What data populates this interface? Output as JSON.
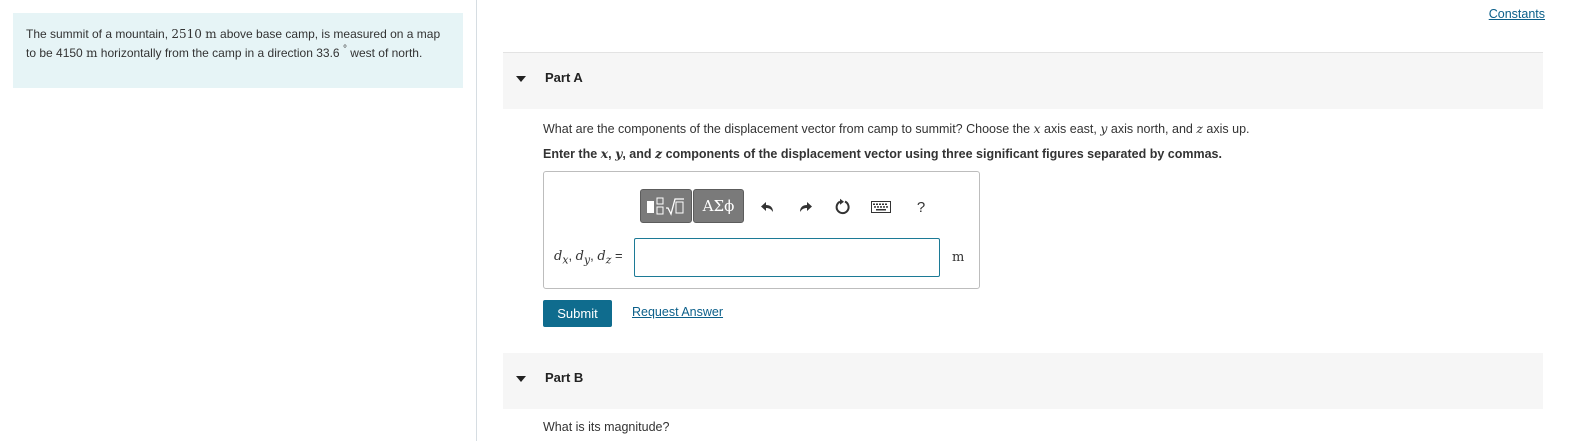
{
  "problem": {
    "lead": "The summit of a mountain, ",
    "height_value": "2510",
    "height_unit": "m",
    "mid1": " above base camp, is measured on a map to be ",
    "distance_value": "4150",
    "distance_unit": "m",
    "mid2": " horizontally from the camp in a direction ",
    "angle_value": "33.6",
    "degree_symbol": "°",
    "tail": " west of north."
  },
  "header": {
    "constants_link": "Constants"
  },
  "part_a": {
    "title": "Part A",
    "question": {
      "q1": "What are the components of the displacement vector from camp to summit? Choose the ",
      "x_var": "x",
      "q2": " axis east, ",
      "y_var": "y",
      "q3": " axis north, and ",
      "z_var": "z",
      "q4": " axis up."
    },
    "instruction": {
      "i1": "Enter the ",
      "x_var": "x",
      "sep1": ", ",
      "y_var": "y",
      "sep2": ", and ",
      "z_var": "z",
      "i2": " components of the displacement vector using three significant figures separated by commas."
    },
    "toolbar": {
      "symbols_label": "ΑΣϕ",
      "help_label": "?"
    },
    "answer": {
      "var_d": "d",
      "sub_x": "x",
      "sub_y": "y",
      "sub_z": "z",
      "comma": ", ",
      "equals": " =",
      "input_value": "",
      "unit": "m"
    },
    "submit_label": "Submit",
    "request_answer_label": "Request Answer"
  },
  "part_b": {
    "title": "Part B",
    "question": "What is its magnitude?"
  }
}
